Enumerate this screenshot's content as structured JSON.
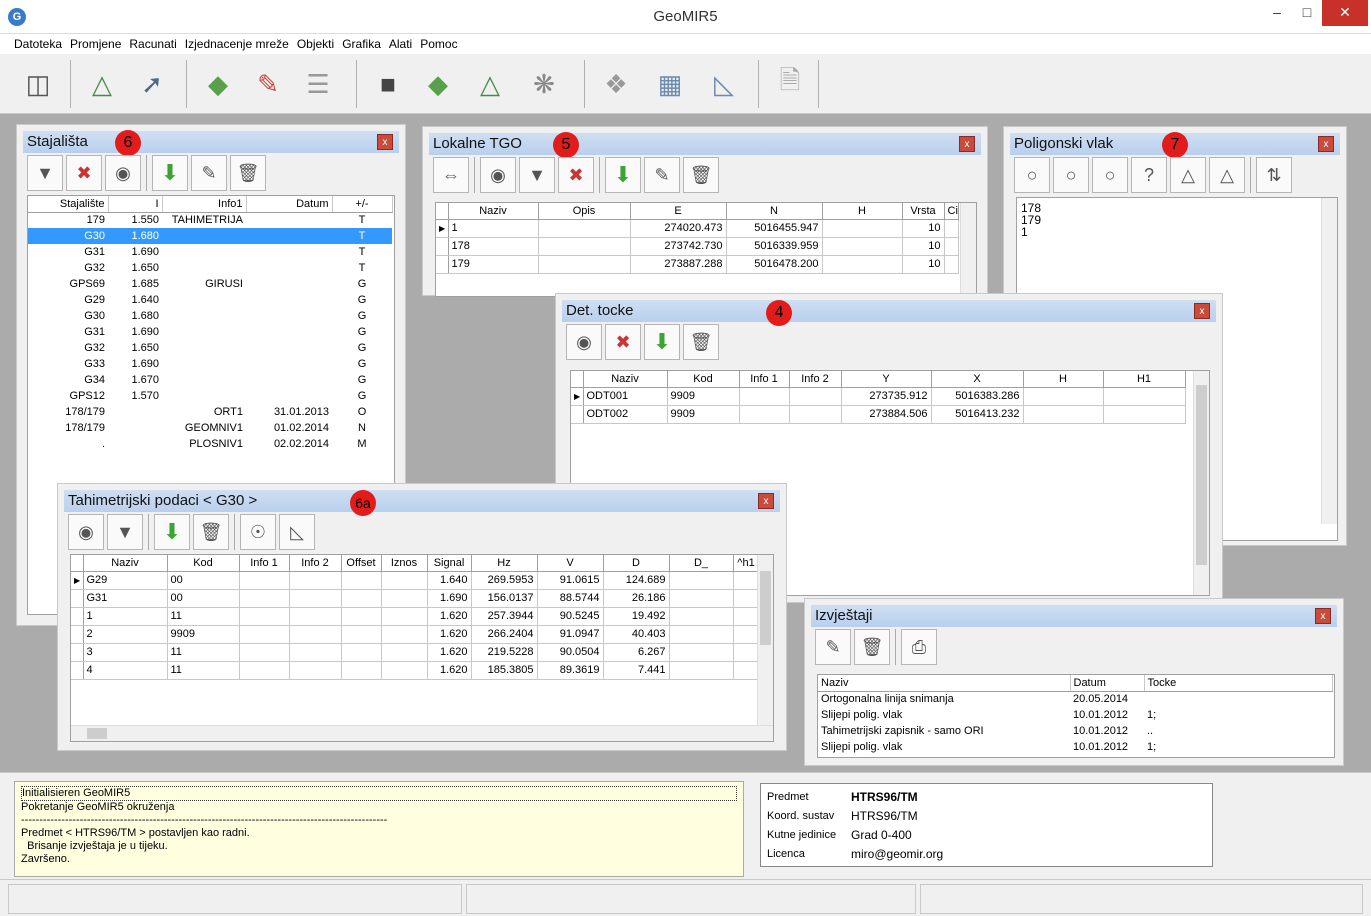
{
  "app": {
    "title": "GeoMIR5"
  },
  "menu": [
    "Datoteka",
    "Promjene",
    "Racunati",
    "Izjednacenje mreže",
    "Objekti",
    "Grafika",
    "Alati",
    "Pomoc"
  ],
  "toolbar_icons": [
    "file-cabinet-icon",
    "total-station-import-icon",
    "coordinate-import-icon",
    "map-layer-icon",
    "pencil-layer-icon",
    "stack-icon",
    "camera-calc-icon",
    "map-calc-icon",
    "tripod-calc-icon",
    "network-icon",
    "puzzle-icon",
    "grid-icon",
    "drafting-icon",
    "settings-doc-icon"
  ],
  "stajalista": {
    "title": "Stajališta",
    "badge": "6",
    "columns": [
      "Stajalište",
      "I",
      "Info1",
      "Datum",
      "+/-"
    ],
    "rows": [
      [
        "179",
        "1.550",
        "TAHIMETRIJA",
        "",
        "T"
      ],
      [
        "G30",
        "1.680",
        "",
        "",
        "T"
      ],
      [
        "G31",
        "1.690",
        "",
        "",
        "T"
      ],
      [
        "G32",
        "1.650",
        "",
        "",
        "T"
      ],
      [
        "GPS69",
        "1.685",
        "GIRUSI",
        "",
        "G"
      ],
      [
        "G29",
        "1.640",
        "",
        "",
        "G"
      ],
      [
        "G30",
        "1.680",
        "",
        "",
        "G"
      ],
      [
        "G31",
        "1.690",
        "",
        "",
        "G"
      ],
      [
        "G32",
        "1.650",
        "",
        "",
        "G"
      ],
      [
        "G33",
        "1.690",
        "",
        "",
        "G"
      ],
      [
        "G34",
        "1.670",
        "",
        "",
        "G"
      ],
      [
        "GPS12",
        "1.570",
        "",
        "",
        "G"
      ],
      [
        "178/179",
        "",
        "ORT1",
        "31.01.2013",
        "O"
      ],
      [
        "178/179",
        "",
        "GEOMNIV1",
        "01.02.2014",
        "N"
      ],
      [
        ".",
        "",
        "PLOSNIV1",
        "02.02.2014",
        "M"
      ]
    ]
  },
  "lokalne": {
    "title": "Lokalne TGO",
    "badge": "5",
    "columns": [
      "Naziv",
      "Opis",
      "E",
      "N",
      "H",
      "Vrsta",
      "Ci"
    ],
    "rows": [
      [
        "1",
        "",
        "274020.473",
        "5016455.947",
        "",
        "10",
        ""
      ],
      [
        "178",
        "",
        "273742.730",
        "5016339.959",
        "",
        "10",
        ""
      ],
      [
        "179",
        "",
        "273887.288",
        "5016478.200",
        "",
        "10",
        ""
      ]
    ]
  },
  "poligonski": {
    "title": "Poligonski vlak",
    "badge": "7",
    "items": [
      "178",
      "179",
      "1"
    ]
  },
  "det": {
    "title": "Det. tocke",
    "badge": "4",
    "columns": [
      "Naziv",
      "Kod",
      "Info 1",
      "Info 2",
      "Y",
      "X",
      "H",
      "H1"
    ],
    "rows": [
      [
        "ODT001",
        "9909",
        "",
        "",
        "273735.912",
        "5016383.286",
        "",
        ""
      ],
      [
        "ODT002",
        "9909",
        "",
        "",
        "273884.506",
        "5016413.232",
        "",
        ""
      ]
    ]
  },
  "tahi": {
    "title": "Tahimetrijski podaci < G30 >",
    "badge": "6a",
    "columns": [
      "Naziv",
      "Kod",
      "Info 1",
      "Info 2",
      "Offset",
      "Iznos",
      "Signal",
      "Hz",
      "V",
      "D",
      "D_",
      "^h1"
    ],
    "rows": [
      [
        "G29",
        "00",
        "",
        "",
        "",
        "",
        "1.640",
        "269.5953",
        "91.0615",
        "124.689",
        "",
        ""
      ],
      [
        "G31",
        "00",
        "",
        "",
        "",
        "",
        "1.690",
        "156.0137",
        "88.5744",
        "26.186",
        "",
        ""
      ],
      [
        "1",
        "11",
        "",
        "",
        "",
        "",
        "1.620",
        "257.3944",
        "90.5245",
        "19.492",
        "",
        ""
      ],
      [
        "2",
        "9909",
        "",
        "",
        "",
        "",
        "1.620",
        "266.2404",
        "91.0947",
        "40.403",
        "",
        ""
      ],
      [
        "3",
        "11",
        "",
        "",
        "",
        "",
        "1.620",
        "219.5228",
        "90.0504",
        "6.267",
        "",
        ""
      ],
      [
        "4",
        "11",
        "",
        "",
        "",
        "",
        "1.620",
        "185.3805",
        "89.3619",
        "7.441",
        "",
        ""
      ]
    ]
  },
  "izvjestaji": {
    "title": "Izvještaji",
    "columns": [
      "Naziv",
      "Datum",
      "Tocke"
    ],
    "rows": [
      [
        "Ortogonalna linija snimanja",
        "20.05.2014",
        ""
      ],
      [
        "Slijepi polig. vlak",
        "10.01.2012",
        "1;"
      ],
      [
        "Tahimetrijski zapisnik - samo ORI",
        "10.01.2012",
        ".."
      ],
      [
        "Slijepi polig. vlak",
        "10.01.2012",
        "1;"
      ]
    ]
  },
  "log": [
    "Initialisieren GeoMIR5",
    "Pokretanje GeoMIR5 okruženja",
    "----------------------------------------------------------------------------------------------------",
    "Predmet < HTRS96/TM > postavljen kao radni.",
    "  Brisanje izvještaja je u tijeku.",
    "Završeno."
  ],
  "info": {
    "predmet_label": "Predmet",
    "predmet": "HTRS96/TM",
    "koord_label": "Koord. sustav",
    "koord": "HTRS96/TM",
    "kut_label": "Kutne jedinice",
    "kut": "Grad 0-400",
    "lic_label": "Licenca",
    "lic": "miro@geomir.org"
  }
}
